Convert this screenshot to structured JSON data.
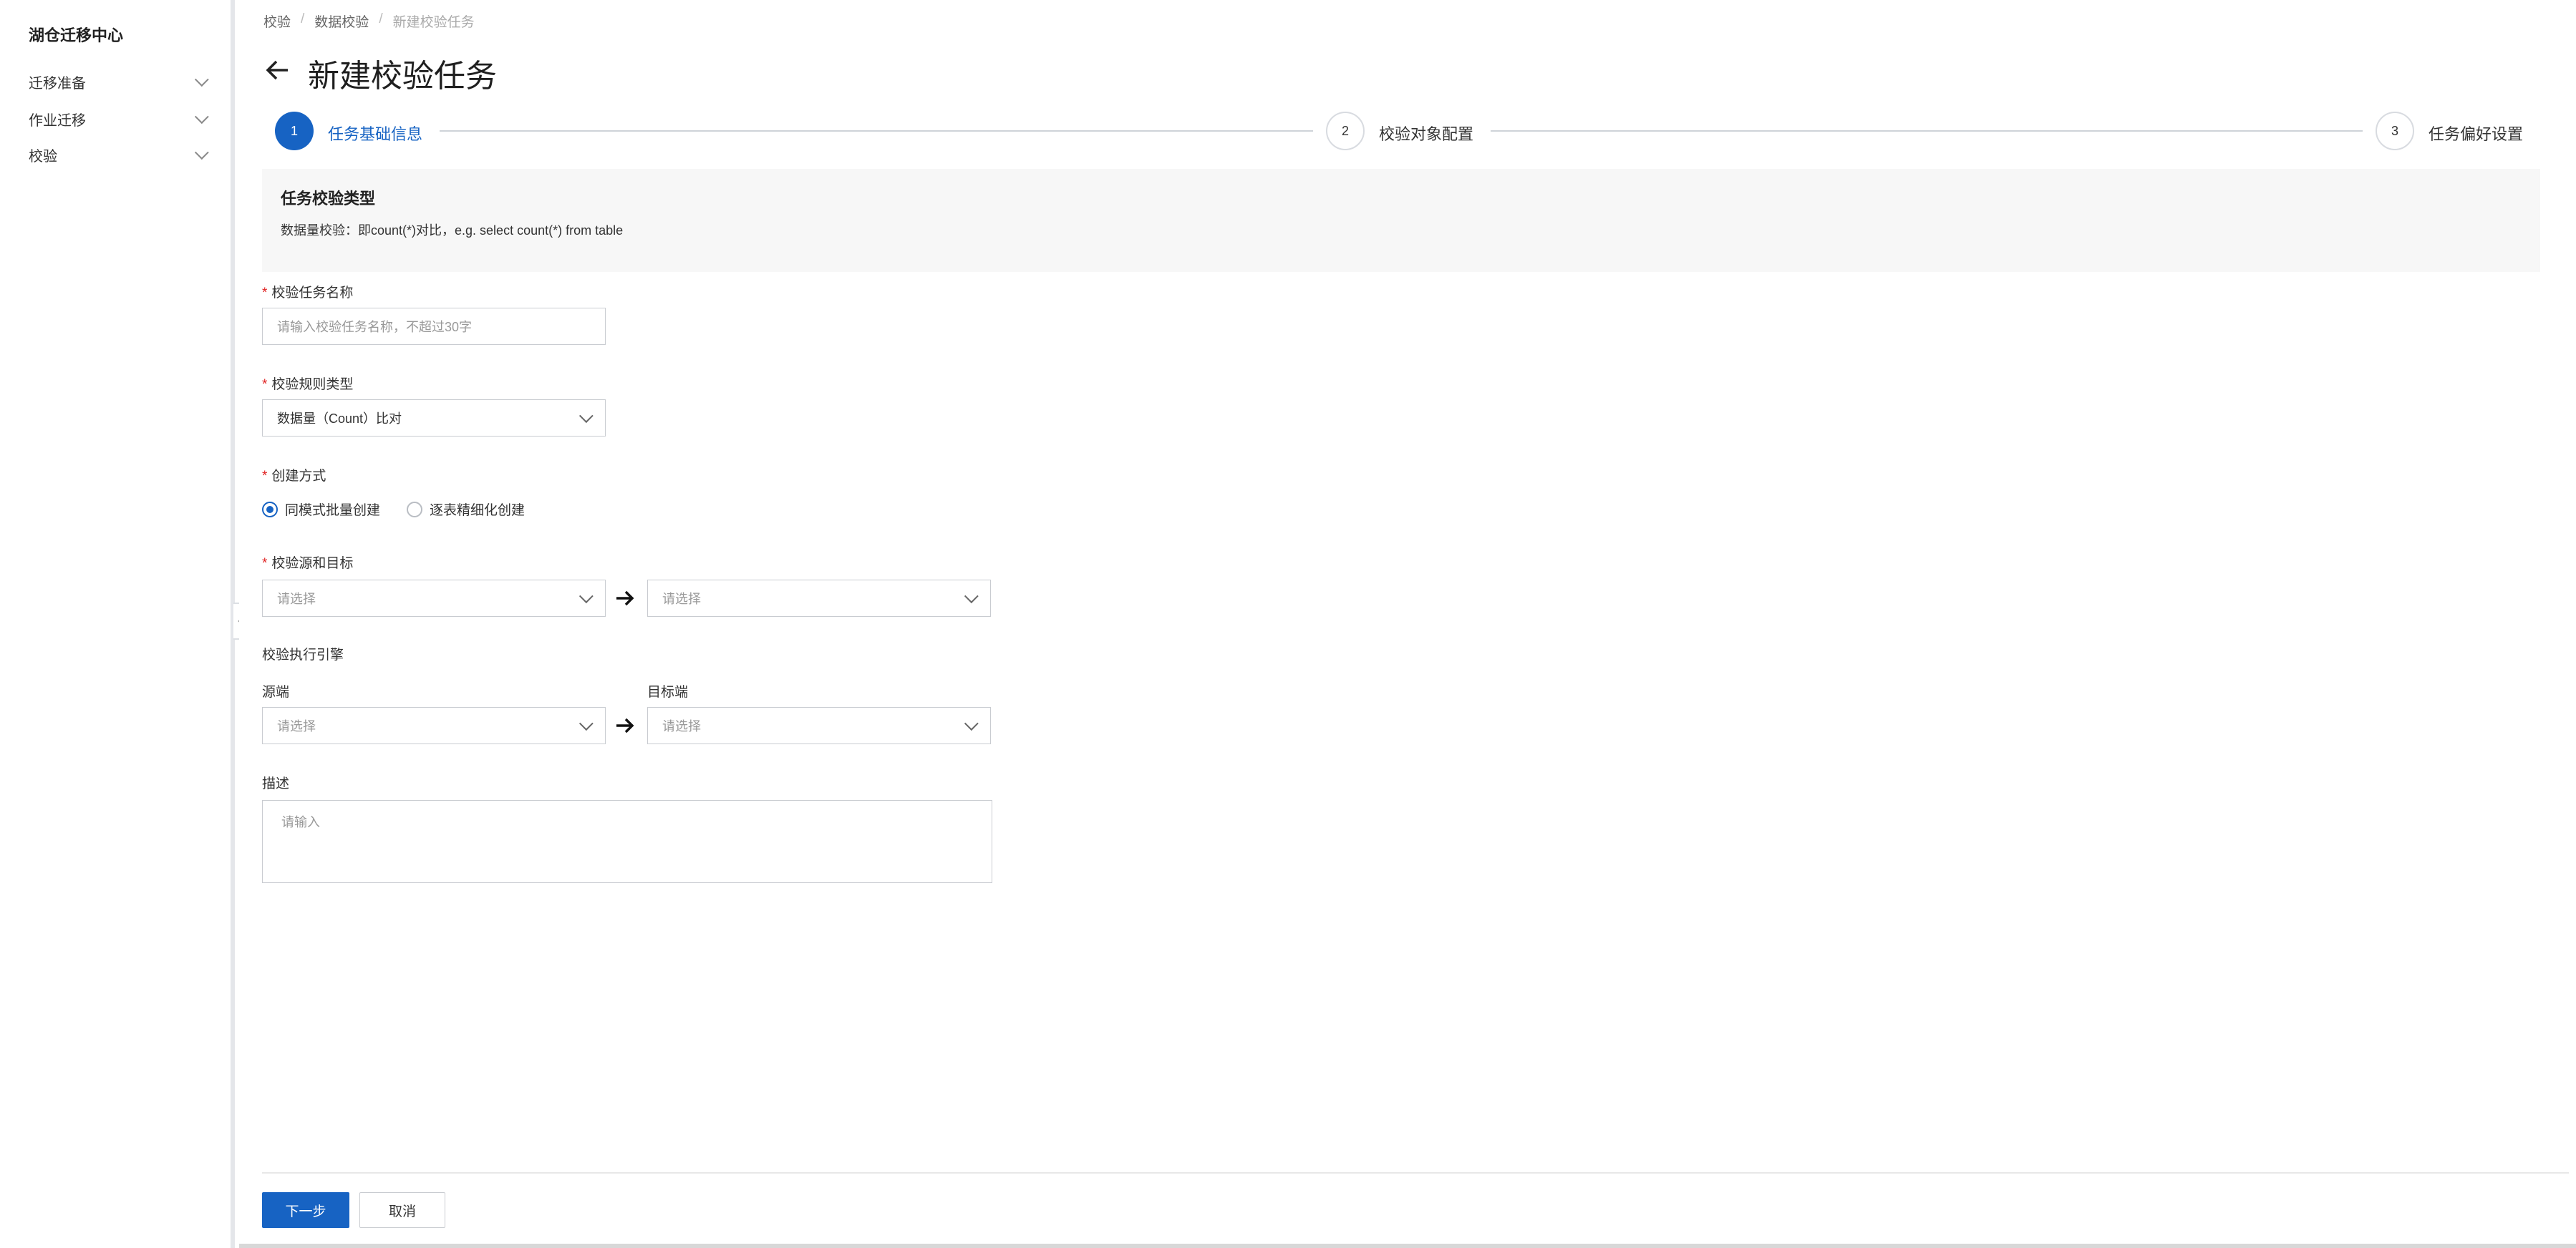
{
  "sidebar": {
    "title": "湖仓迁移中心",
    "items": [
      {
        "label": "迁移准备"
      },
      {
        "label": "作业迁移"
      },
      {
        "label": "校验"
      }
    ]
  },
  "breadcrumb": [
    "校验",
    "数据校验",
    "新建校验任务"
  ],
  "page_title": "新建校验任务",
  "steps": [
    {
      "number": "1",
      "label": "任务基础信息",
      "state": "active"
    },
    {
      "number": "2",
      "label": "校验对象配置",
      "state": "inactive"
    },
    {
      "number": "3",
      "label": "任务偏好设置",
      "state": "inactive"
    }
  ],
  "info_box": {
    "title": "任务校验类型",
    "description": "数据量校验：即count(*)对比，e.g. select count(*) from table"
  },
  "form": {
    "task_name": {
      "label": "校验任务名称",
      "placeholder": "请输入校验任务名称，不超过30字"
    },
    "rule_type": {
      "label": "校验规则类型",
      "value": "数据量（Count）比对"
    },
    "create_mode": {
      "label": "创建方式",
      "options": [
        {
          "label": "同模式批量创建",
          "checked": true
        },
        {
          "label": "逐表精细化创建",
          "checked": false
        }
      ]
    },
    "source_target": {
      "label": "校验源和目标",
      "source_placeholder": "请选择",
      "target_placeholder": "请选择"
    },
    "engine": {
      "label": "校验执行引擎",
      "source_label": "源端",
      "target_label": "目标端",
      "source_placeholder": "请选择",
      "target_placeholder": "请选择"
    },
    "description": {
      "label": "描述",
      "placeholder": "请输入"
    }
  },
  "footer": {
    "next_label": "下一步",
    "cancel_label": "取消"
  },
  "colors": {
    "accent": "#1763c3",
    "required": "#e02020"
  },
  "icons": [
    "chevron-down-icon",
    "arrow-left-icon",
    "arrow-right-icon",
    "chevron-left-icon"
  ]
}
